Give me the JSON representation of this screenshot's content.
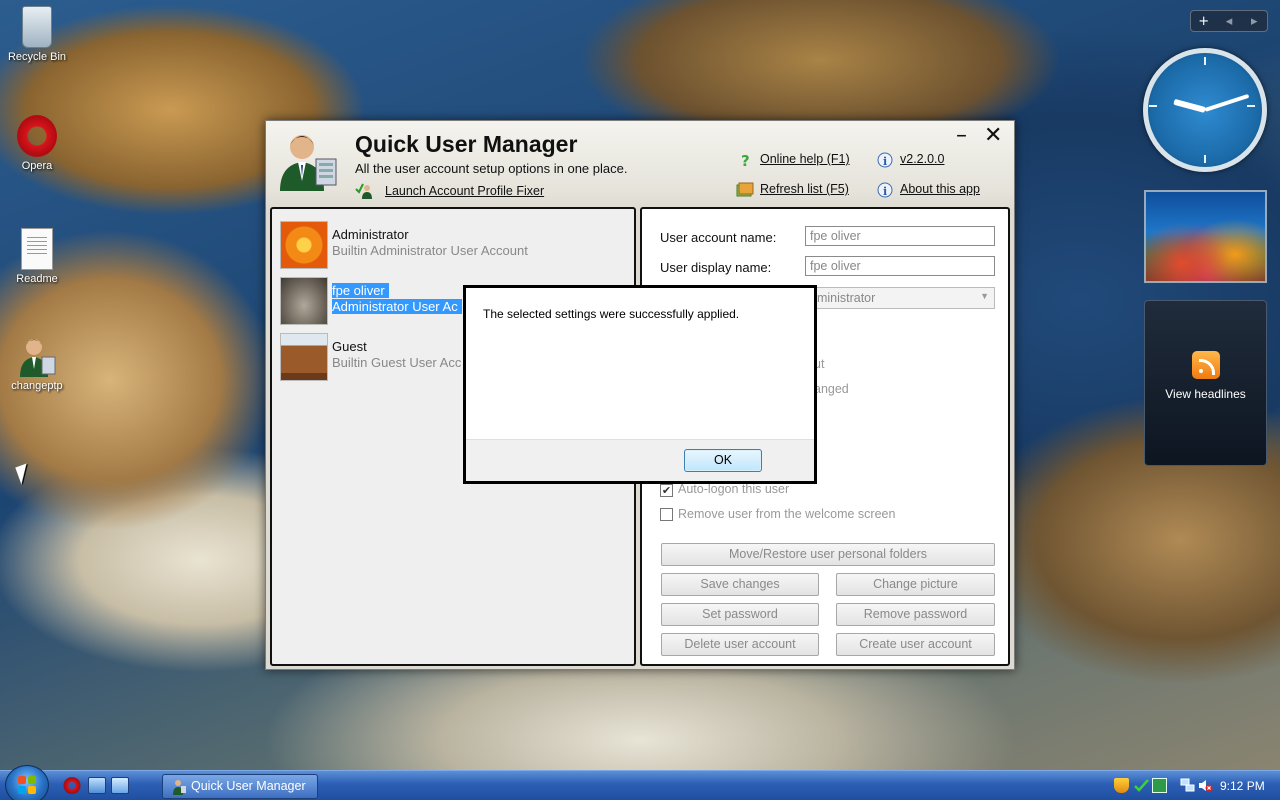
{
  "desktop": {
    "icons": [
      {
        "label": "Recycle Bin"
      },
      {
        "label": "Opera"
      },
      {
        "label": "Readme"
      },
      {
        "label": "changeptp"
      }
    ]
  },
  "gadgets": {
    "feed_label": "View headlines",
    "bar_add": "+",
    "bar_prev": "◂",
    "bar_next": "▸"
  },
  "app": {
    "title": "Quick User Manager",
    "subtitle": "All the user account setup options in one place.",
    "launch_fixer": "Launch Account Profile Fixer",
    "online_help": "Online help (F1)",
    "refresh": "Refresh list (F5)",
    "version": "v2.2.0.0",
    "about": "About this app",
    "minimize": "–",
    "close": "✕",
    "users": [
      {
        "name": "Administrator",
        "desc": "Builtin Administrator User Account"
      },
      {
        "name": "fpe oliver",
        "desc": "Administrator User Ac"
      },
      {
        "name": "Guest",
        "desc": "Builtin Guest User Acc"
      }
    ],
    "details": {
      "account_name_label": "User account name:",
      "account_name_value": "fpe oliver",
      "display_name_label": "User display name:",
      "display_name_value": "fpe oliver",
      "group_value": "dministrator",
      "faded_1": "ut",
      "faded_2": "anged",
      "faded_3": "l",
      "auto_logon": "Auto-logon this user",
      "remove_welcome": "Remove user from the welcome screen"
    },
    "buttons": {
      "move_restore": "Move/Restore user personal folders",
      "save": "Save changes",
      "change_picture": "Change picture",
      "set_password": "Set password",
      "remove_password": "Remove password",
      "delete_user": "Delete user account",
      "create_user": "Create user account"
    }
  },
  "dialog": {
    "message": "The selected settings were successfully applied.",
    "ok": "OK"
  },
  "taskbar": {
    "task_label": "Quick User Manager",
    "time": "9:12 PM"
  },
  "colors": {
    "selection": "#3399ff",
    "taskbar": "#2c5fb5"
  }
}
